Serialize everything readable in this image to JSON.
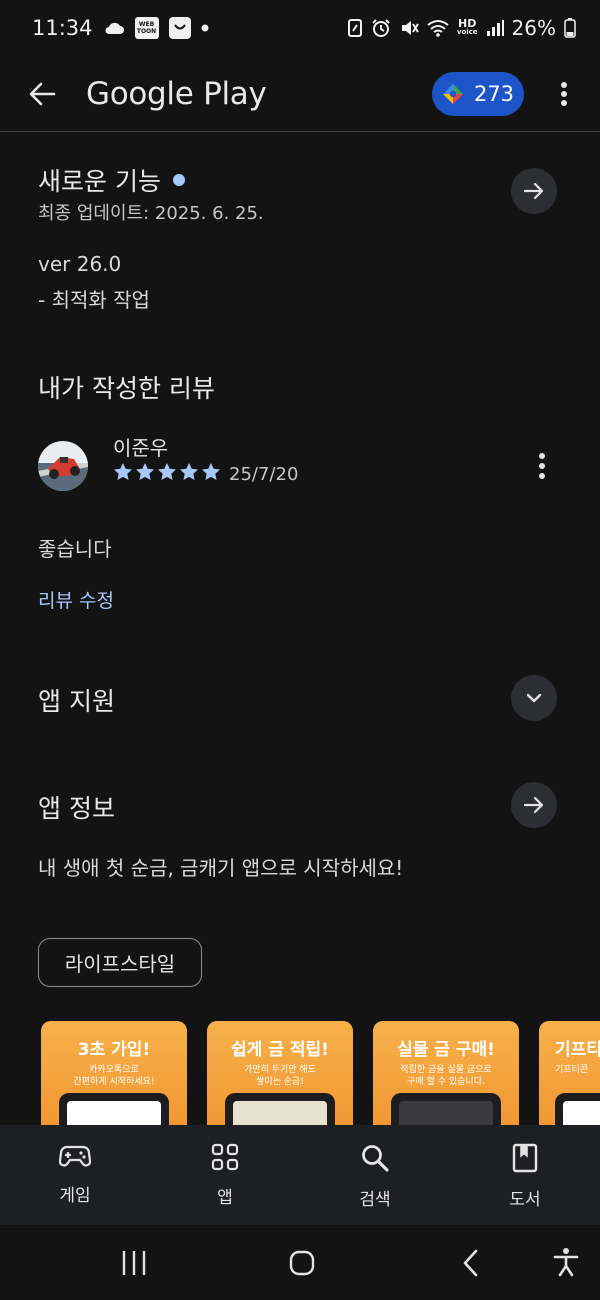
{
  "status_bar": {
    "time": "11:34",
    "webtoon_label": "WEB\nTOON",
    "hd_label": "HD",
    "voice_label": "voice",
    "battery": "26%",
    "notification_icons": [
      "cloud-icon",
      "webtoon-icon",
      "shopping-icon",
      "dot-icon"
    ],
    "system_icons": [
      "nfc-icon",
      "alarm-icon",
      "mute-icon",
      "wifi-icon",
      "hd-voice-icon",
      "signal-icon",
      "battery-icon"
    ]
  },
  "app_bar": {
    "title": "Google Play",
    "points": "273",
    "back_icon": "arrow-left-icon",
    "more_icon": "more-vert-icon"
  },
  "whats_new": {
    "title": "새로운 기능",
    "updated": "최종 업데이트: 2025. 6. 25.",
    "version": "ver 26.0",
    "notes": "- 최적화 작업"
  },
  "my_review": {
    "title": "내가 작성한 리뷰",
    "reviewer": "이준우",
    "rating": 5,
    "date": "25/7/20",
    "text": "좋습니다",
    "edit_link": "리뷰 수정"
  },
  "app_support": {
    "title": "앱 지원"
  },
  "app_info": {
    "title": "앱 정보",
    "description": "내 생애 첫 순금, 금캐기 앱으로 시작하세요!",
    "category_chip": "라이프스타일"
  },
  "screenshots": [
    {
      "title": "3초 가입!",
      "sub": "카카오톡으로\n간편하게 시작하세요!"
    },
    {
      "title": "쉽게 금 적립!",
      "sub": "가만히 두기만 해도\n쌓이는 순금!"
    },
    {
      "title": "실물 금 구매!",
      "sub": "적립한 금을 실물 금으로\n구매 할 수 있습니다."
    },
    {
      "title": "기프티",
      "sub": "기프티콘"
    }
  ],
  "bottom_nav": [
    {
      "label": "게임",
      "icon": "gamepad-icon"
    },
    {
      "label": "앱",
      "icon": "apps-grid-icon"
    },
    {
      "label": "검색",
      "icon": "search-icon"
    },
    {
      "label": "도서",
      "icon": "book-icon"
    }
  ],
  "colors": {
    "background": "#131314",
    "accent_link": "#a8c7fa",
    "points_pill": "#1d54c8",
    "star": "#a8c7fa"
  }
}
